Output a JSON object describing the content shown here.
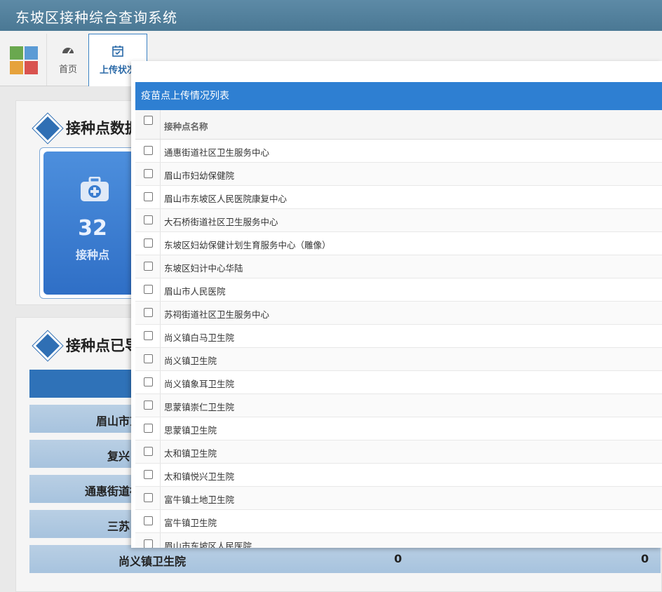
{
  "app": {
    "title": "东坡区接种综合查询系统"
  },
  "tabs": [
    {
      "label": "首页",
      "icon": "dashboard-icon"
    },
    {
      "label": "上传状况",
      "icon": "calendar-check-icon"
    }
  ],
  "section1": {
    "heading": "接种点数据"
  },
  "stat": {
    "value": "32",
    "label": "接种点",
    "icon": "medical-kit-icon"
  },
  "section2": {
    "heading": "接种点已导"
  },
  "background_rows": [
    {
      "name": "眉山市东",
      "a": "",
      "b": ""
    },
    {
      "name": "复兴",
      "a": "",
      "b": ""
    },
    {
      "name": "通惠街道社",
      "a": "",
      "b": ""
    },
    {
      "name": "三苏",
      "a": "",
      "b": ""
    },
    {
      "name": "尚义镇卫生院",
      "a": "0",
      "b": "0"
    }
  ],
  "modal": {
    "title": "疫苗点上传情况列表",
    "column_header": "接种点名称",
    "rows": [
      "通惠街道社区卫生服务中心",
      "眉山市妇幼保健院",
      "眉山市东坡区人民医院康复中心",
      "大石桥街道社区卫生服务中心",
      "东坡区妇幼保健计划生育服务中心（雕像）",
      "东坡区妇计中心华陆",
      "眉山市人民医院",
      "苏祠街道社区卫生服务中心",
      "尚义镇白马卫生院",
      "尚义镇卫生院",
      "尚义镇象耳卫生院",
      "思蒙镇崇仁卫生院",
      "思蒙镇卫生院",
      "太和镇卫生院",
      "太和镇悦兴卫生院",
      "富牛镇土地卫生院",
      "富牛镇卫生院",
      "眉山市东坡区人民医院"
    ]
  },
  "colors": {
    "header": "#4a7894",
    "accent": "#2e7fd2",
    "card": "#3a7dd0"
  }
}
